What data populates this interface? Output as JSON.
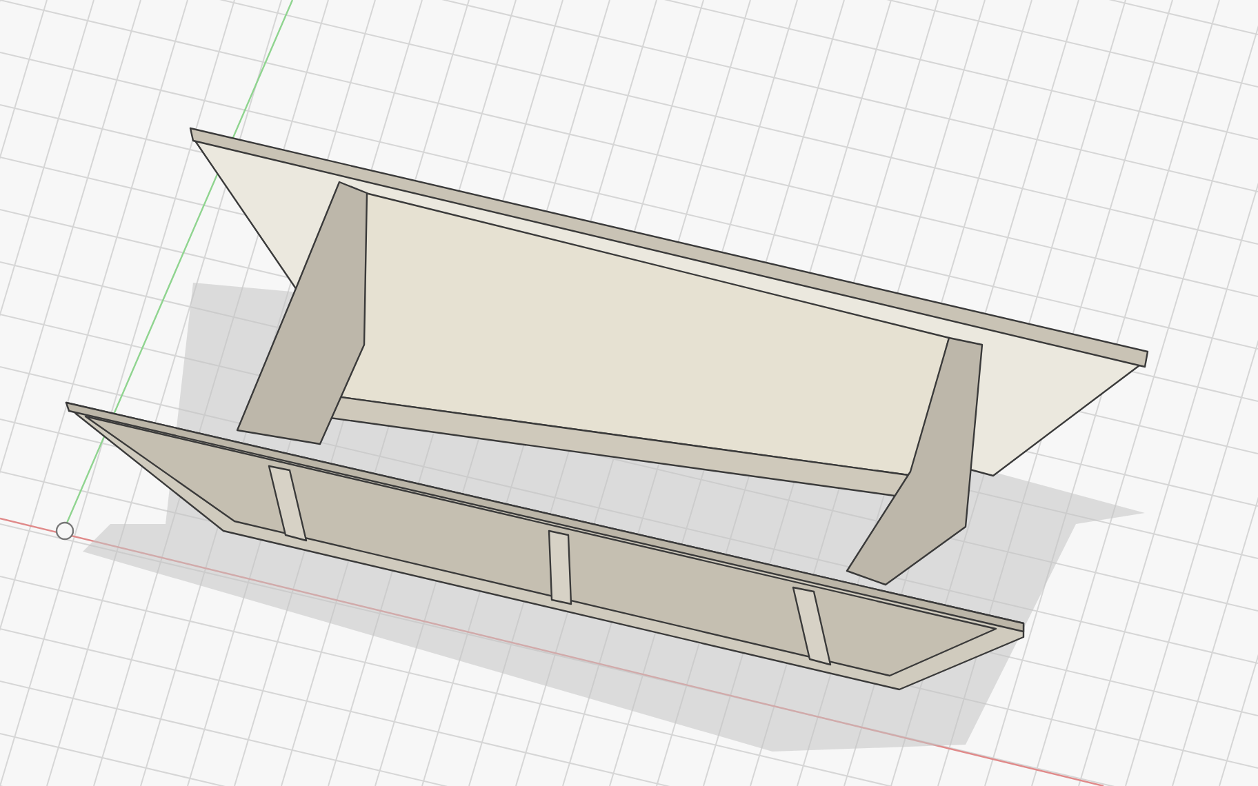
{
  "viewport": {
    "grid_visible": true,
    "axes_visible": true,
    "origin_marker": true,
    "shadow": true
  }
}
